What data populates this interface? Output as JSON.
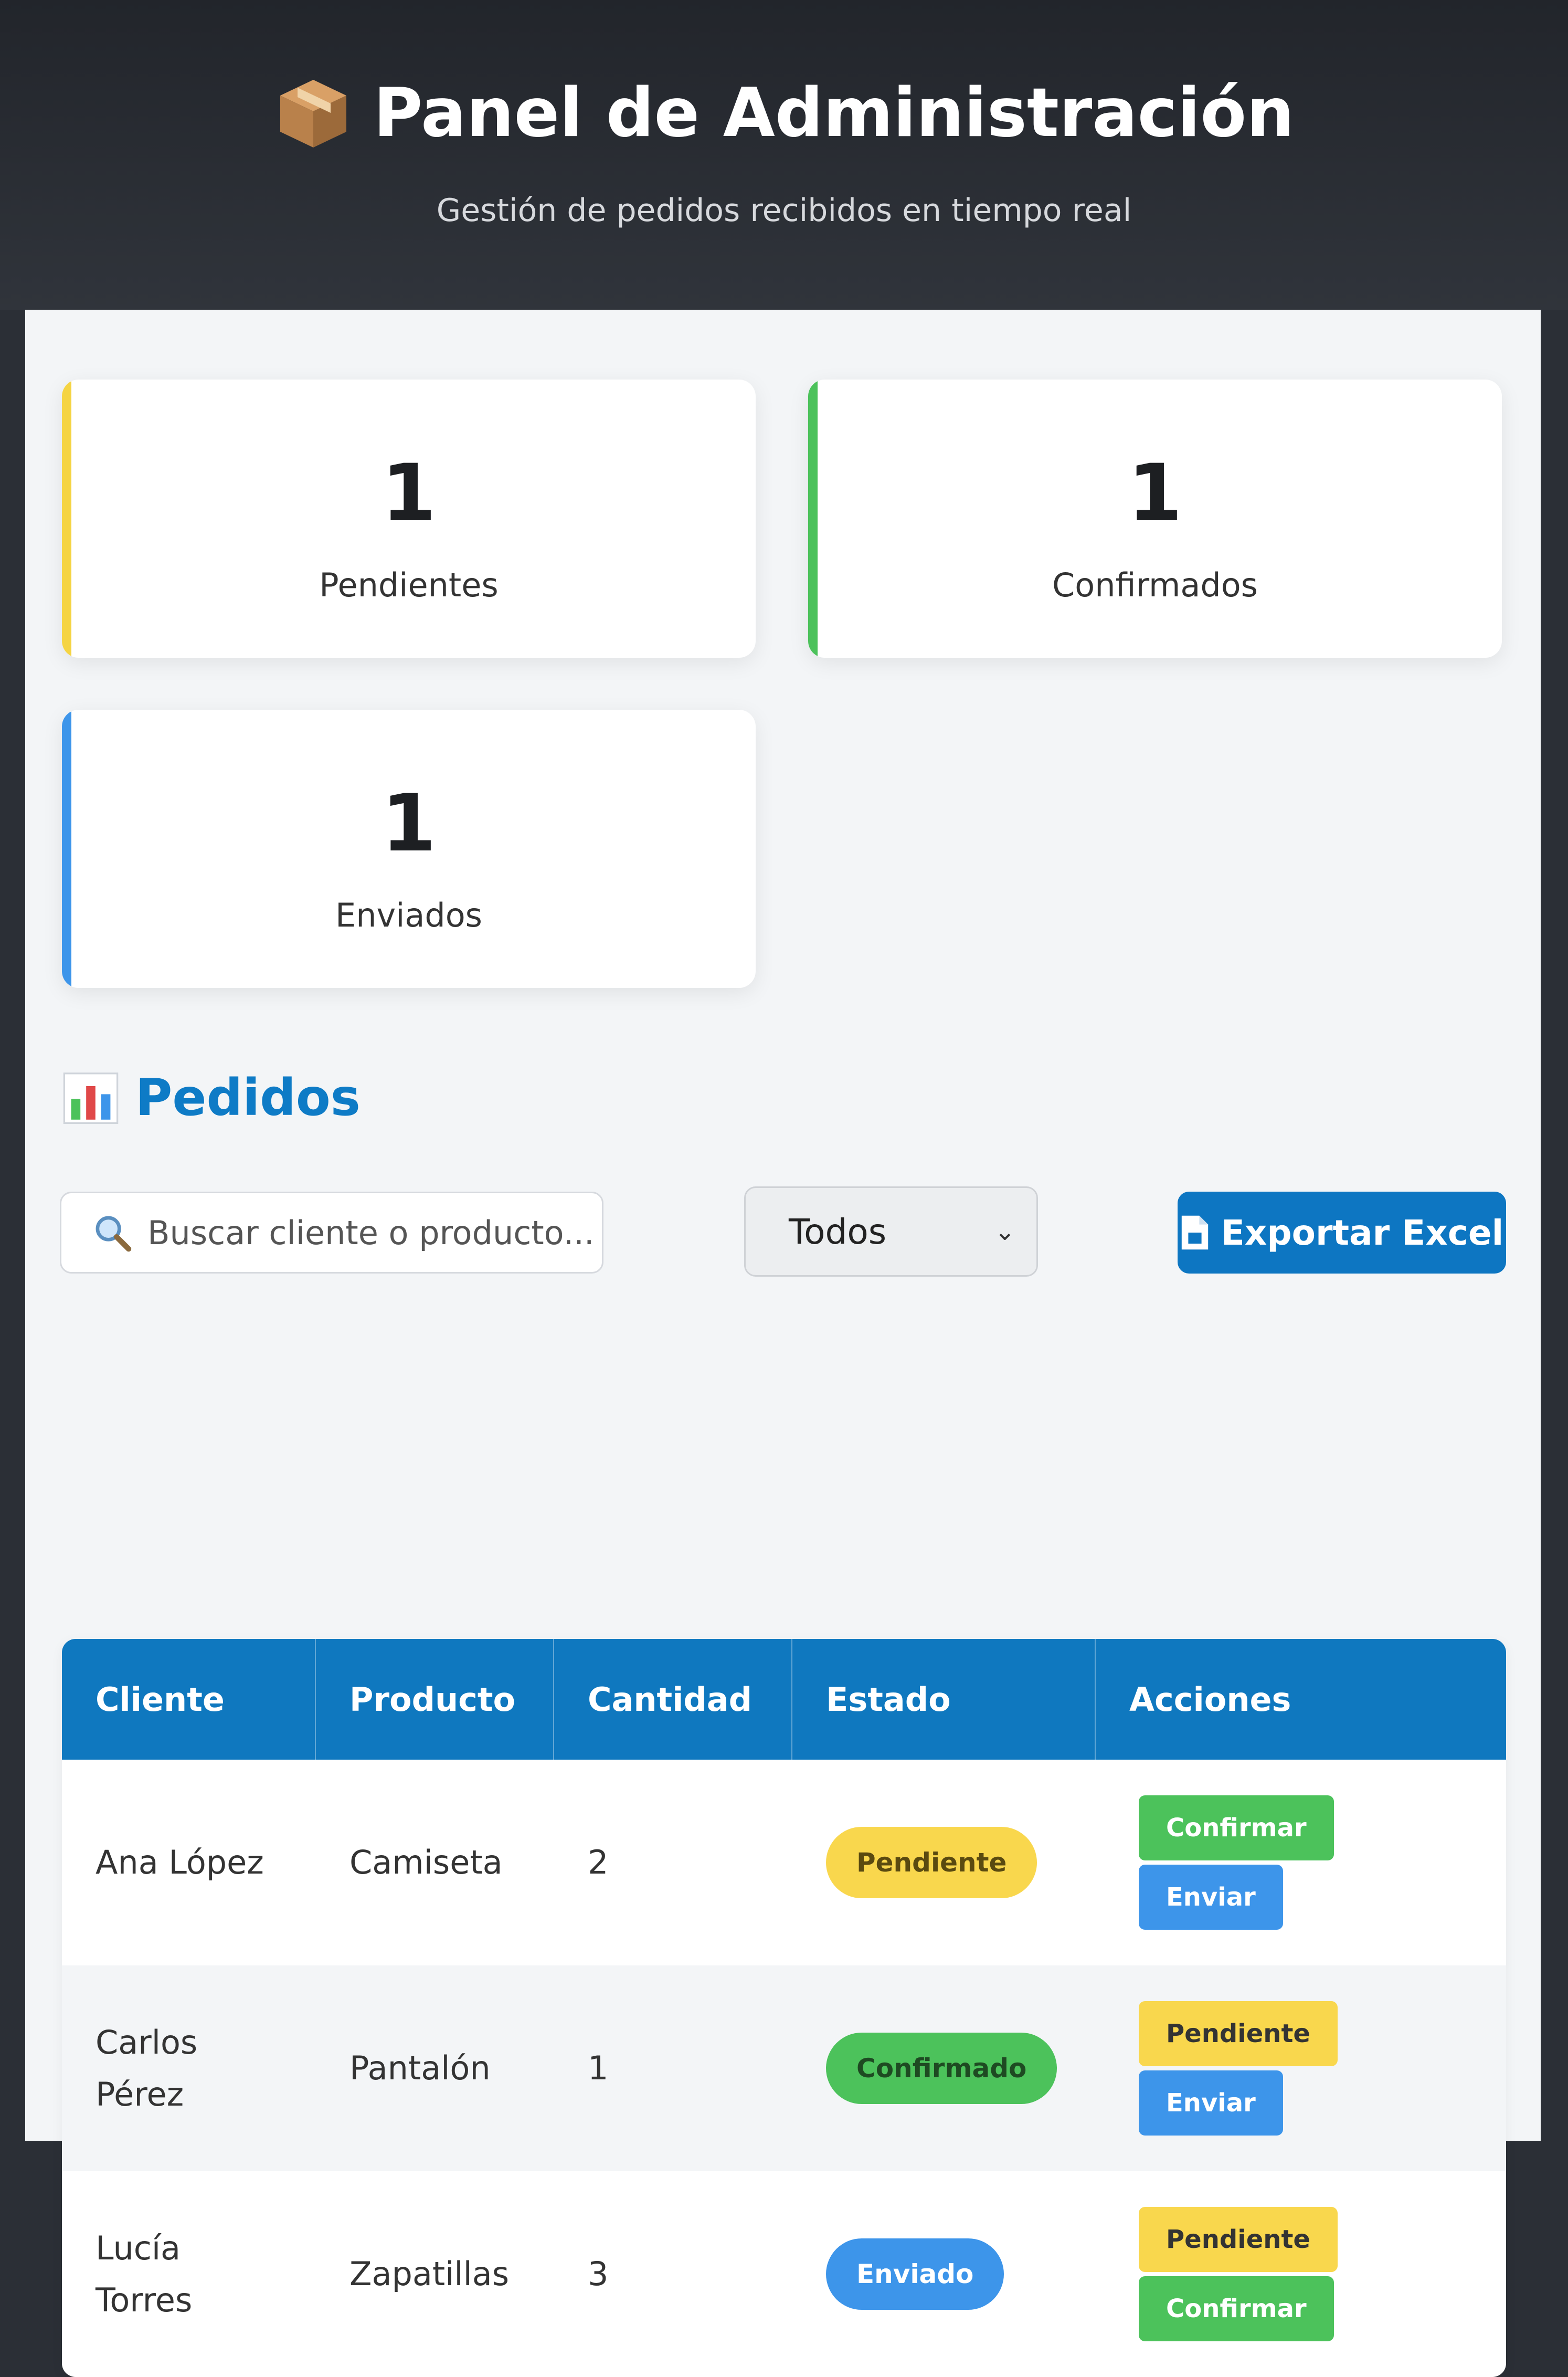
{
  "header": {
    "title": "Panel de Administración",
    "subtitle": "Gestión de pedidos recibidos en tiempo real",
    "icon": "package-icon"
  },
  "stats": [
    {
      "value": "1",
      "label": "Pendientes",
      "accent": "#f5d443"
    },
    {
      "value": "1",
      "label": "Confirmados",
      "accent": "#4cc25b"
    },
    {
      "value": "1",
      "label": "Enviados",
      "accent": "#3d95ea"
    }
  ],
  "section": {
    "title": "Pedidos",
    "icon": "bar-chart-icon"
  },
  "toolbar": {
    "search_placeholder": "Buscar cliente o producto...",
    "filter_selected": "Todos",
    "export_label": "Exportar Excel"
  },
  "table": {
    "headers": [
      "Cliente",
      "Producto",
      "Cantidad",
      "Estado",
      "Acciones"
    ],
    "rows": [
      {
        "cliente": "Ana López",
        "producto": "Camiseta",
        "cantidad": "2",
        "estado": "Pendiente",
        "actions": [
          "Confirmar",
          "Enviar"
        ]
      },
      {
        "cliente": "Carlos Pérez",
        "producto": "Pantalón",
        "cantidad": "1",
        "estado": "Confirmado",
        "actions": [
          "Pendiente",
          "Enviar"
        ]
      },
      {
        "cliente": "Lucía Torres",
        "producto": "Zapatillas",
        "cantidad": "3",
        "estado": "Enviado",
        "actions": [
          "Pendiente",
          "Confirmar"
        ]
      }
    ]
  },
  "colors": {
    "header_bg": "#2b2f36",
    "primary": "#0f78bf",
    "pending": "#f9d74d",
    "confirmed": "#4cc25b",
    "shipped": "#3d95ea"
  }
}
